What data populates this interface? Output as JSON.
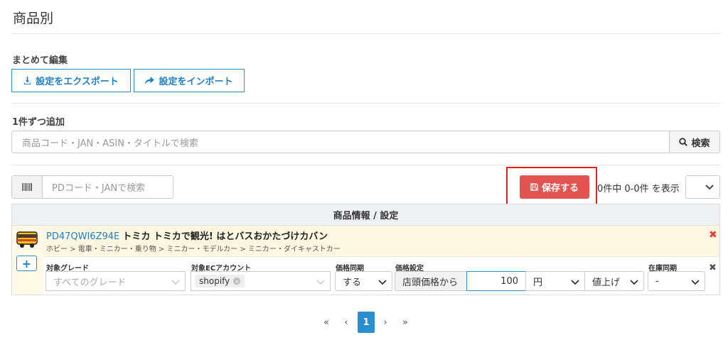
{
  "page": {
    "title": "商品別"
  },
  "bulk_edit": {
    "label": "まとめて編集",
    "export_label": "設定をエクスポート",
    "import_label": "設定をインポート"
  },
  "single_add": {
    "label": "1件ずつ追加",
    "search_placeholder": "商品コード・JAN・ASIN・タイトルで検索",
    "search_button": "検索"
  },
  "list_toolbar": {
    "filter_placeholder": "PDコード・JANで検索",
    "save_button": "保存する",
    "count_text": "0件中 0-0件 を表示"
  },
  "table": {
    "header": "商品情報 / 設定",
    "rows": [
      {
        "product_id": "PD47QWI6Z94E",
        "product_name": "トミカ トミカで観光! はとバスおかたづけカバン",
        "breadcrumb": "ホビー > 電車・ミニカー・乗り物 > ミニカー・モデルカー > ミニカー・ダイキャストカー",
        "settings": {
          "grade_label": "対象グレード",
          "grade_placeholder": "すべてのグレード",
          "account_label": "対象ECアカウント",
          "account_chip": "shopify",
          "price_sync_label": "価格同期",
          "price_sync_value": "する",
          "price_setting_label": "価格設定",
          "price_base": "店頭価格から",
          "price_amount": "100",
          "price_unit": "円",
          "price_direction": "値上げ",
          "stock_sync_label": "在庫同期",
          "stock_sync_value": "-"
        }
      }
    ]
  },
  "pagination": {
    "first": "«",
    "prev": "‹",
    "current": "1",
    "next": "›",
    "last": "»"
  },
  "colors": {
    "accent": "#2a8fd0",
    "danger": "#e25451",
    "highlight": "#e0201b",
    "row_bg": "#fdf6e1"
  },
  "icons": {
    "export": "download-icon",
    "import": "share-arrow-icon",
    "search": "search-icon",
    "barcode": "barcode-icon",
    "save": "floppy-disk-icon",
    "product": "bus-thumbnail",
    "remove": "close-icon"
  }
}
